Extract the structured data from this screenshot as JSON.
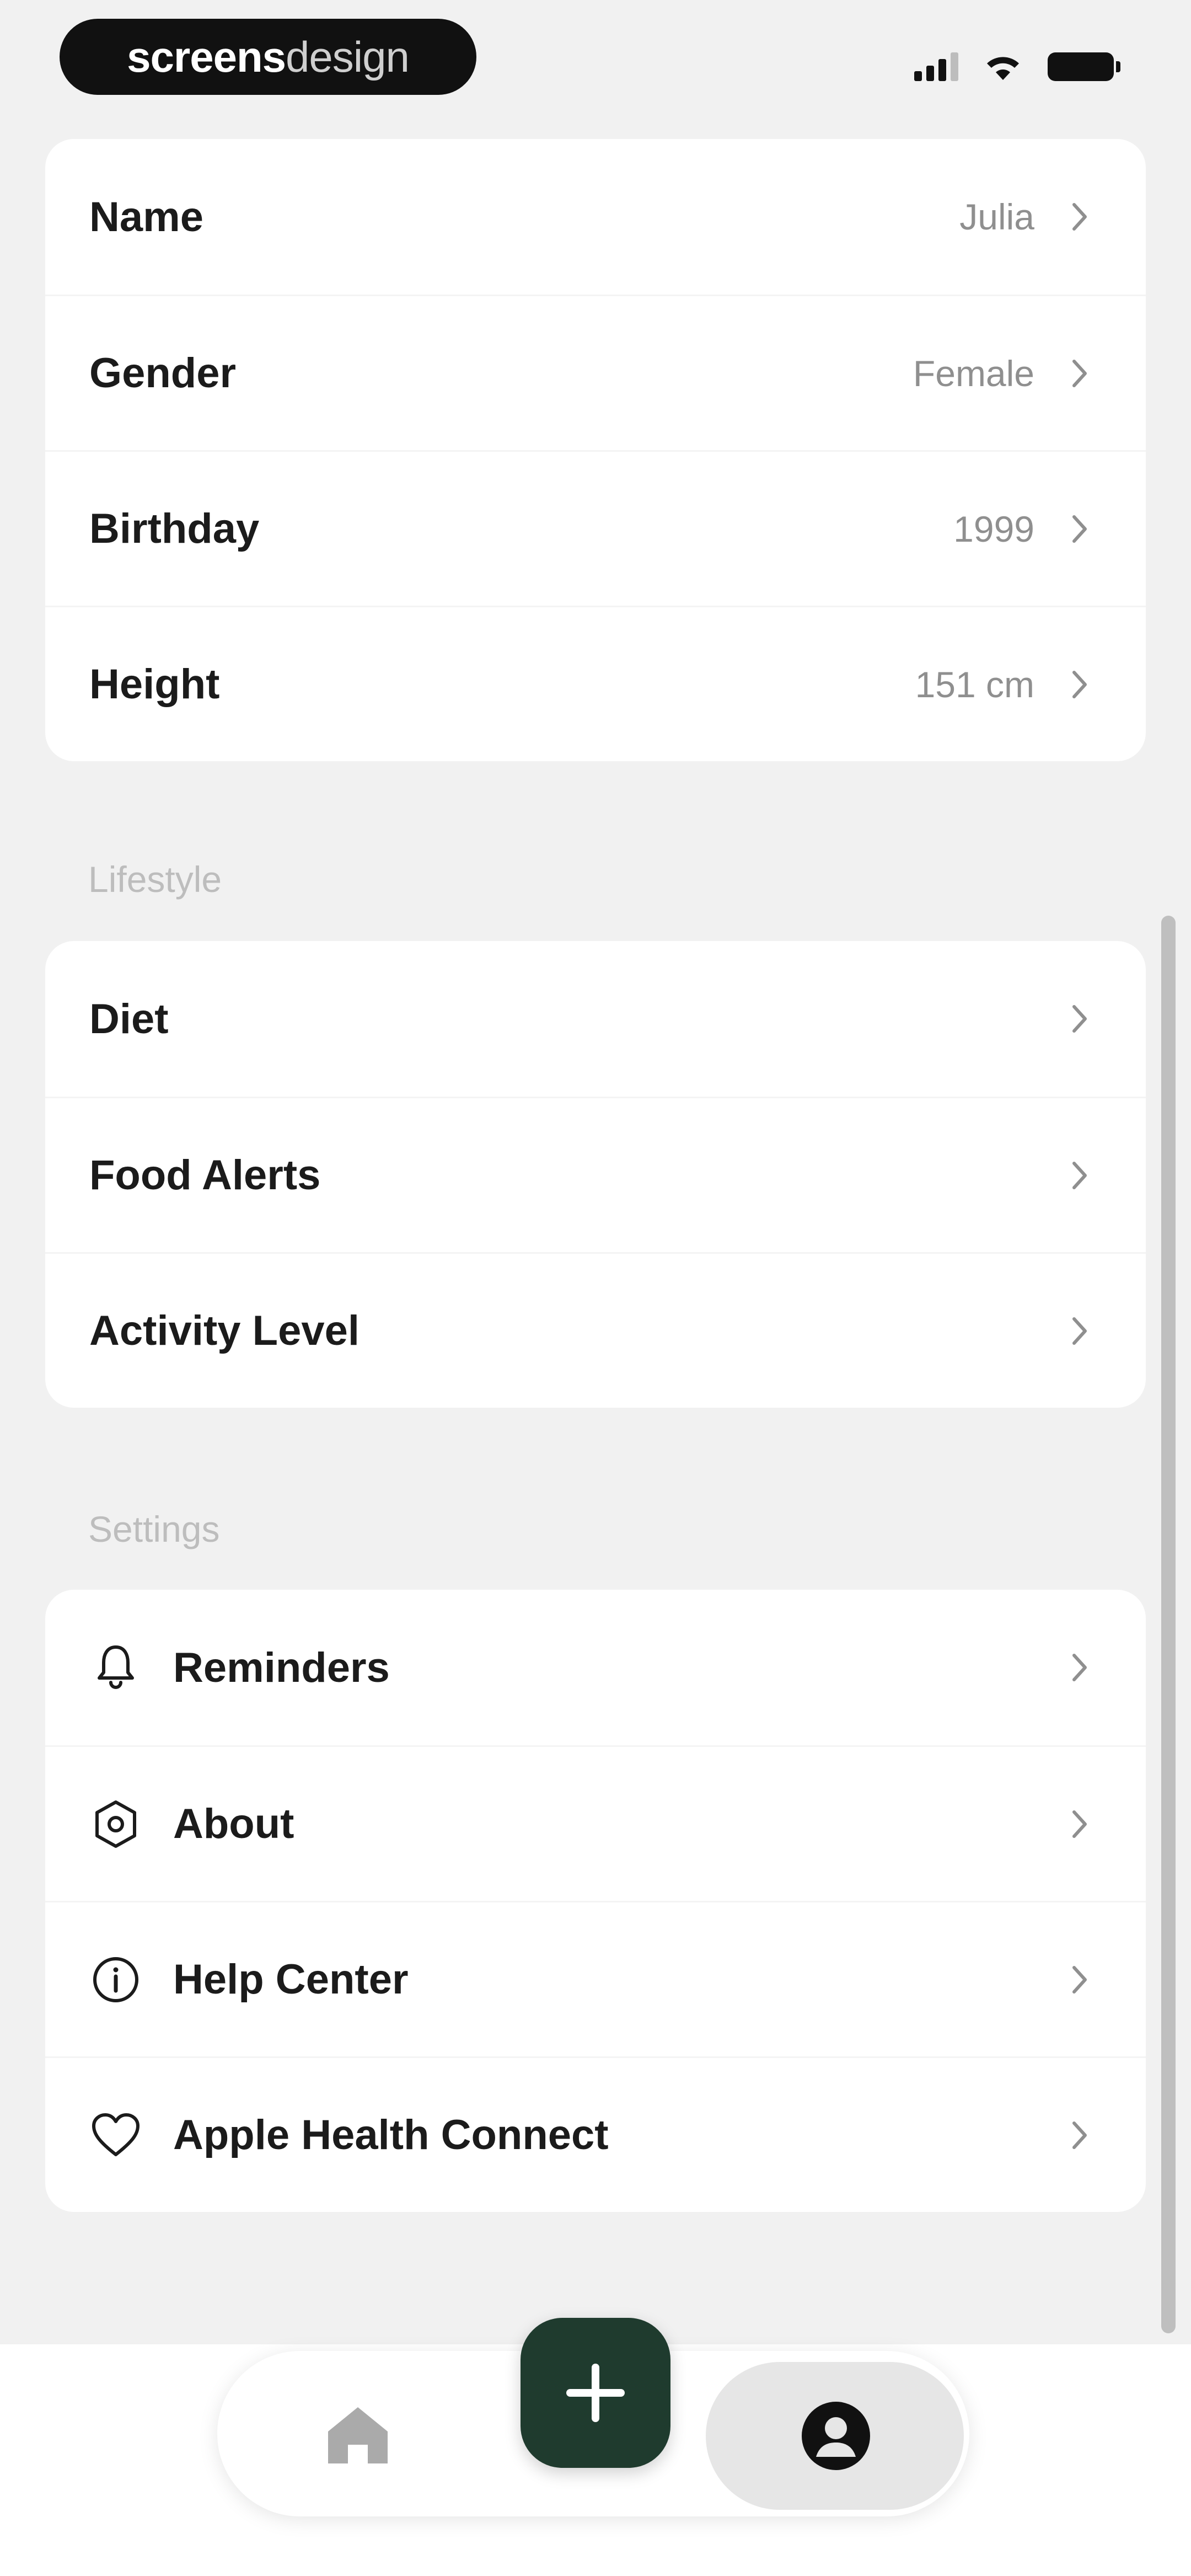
{
  "status_bar": {
    "logo_bold": "screens",
    "logo_light": "design"
  },
  "profile": {
    "rows": [
      {
        "label": "Name",
        "value": "Julia"
      },
      {
        "label": "Gender",
        "value": "Female"
      },
      {
        "label": "Birthday",
        "value": "1999"
      },
      {
        "label": "Height",
        "value": "151 cm"
      }
    ]
  },
  "lifestyle": {
    "title": "Lifestyle",
    "rows": [
      {
        "label": "Diet"
      },
      {
        "label": "Food Alerts"
      },
      {
        "label": "Activity Level"
      }
    ]
  },
  "settings": {
    "title": "Settings",
    "rows": [
      {
        "label": "Reminders",
        "icon": "bell-icon"
      },
      {
        "label": "About",
        "icon": "hexagon-info-icon"
      },
      {
        "label": "Help Center",
        "icon": "info-circle-icon"
      },
      {
        "label": "Apple Health Connect",
        "icon": "heart-icon"
      }
    ]
  },
  "bottom_nav": {
    "items": [
      {
        "name": "home",
        "icon": "home-icon"
      },
      {
        "name": "add",
        "icon": "plus-icon"
      },
      {
        "name": "profile",
        "icon": "user-icon",
        "active": true
      }
    ],
    "accent_color": "#1f3b2e"
  }
}
